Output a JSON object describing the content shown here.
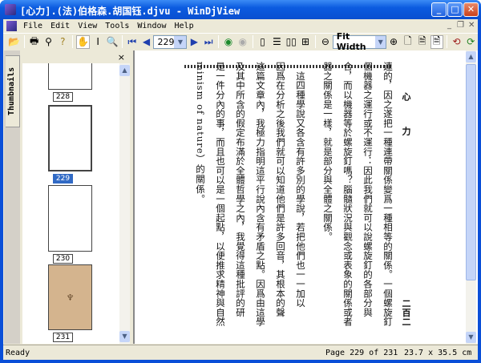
{
  "window": {
    "title": "[心力].(法)伯格森.胡国钰.djvu - WinDjView"
  },
  "menu": [
    "File",
    "Edit",
    "View",
    "Tools",
    "Window",
    "Help"
  ],
  "toolbar": {
    "page_value": "229",
    "zoom_value": "Fit Width"
  },
  "sidebar": {
    "tab_label": "Thumbnails",
    "close": "×",
    "thumbnails": [
      {
        "label": "228"
      },
      {
        "label": "229",
        "selected": true
      },
      {
        "label": "230"
      },
      {
        "label": "231"
      }
    ]
  },
  "page": {
    "header_title": "心 力",
    "page_number": "二百二",
    "columns": [
      "連的，因之遂把一種連帶關係變爲一種相等的關係。一個螺旋釘",
      "個機器之運行或不運行：因此我們就可以說螺旋釘的各部分與",
      "合，而以機器等於螺旋釘嗎？腦髓狀況與觀念或表象的關係或者",
      "器之關係是一樣，就是部分與全體之關係。",
      "　這四種學說又各含有許多別的學說，若把他們也一一加以",
      "因爲在分析之後我們就可以知道他們是許多回音，其根本的聲",
      "這篇文章內，我極力指明這平行說內含有矛盾之點。因爲由這學",
      "及其中所含的假定布滿於全體哲學之內，我覺得這種批評的研",
      "是一件分內的事，而且也可以是一個起點，以便推求精神與自然",
      "minism of nature）的關係。"
    ]
  },
  "status": {
    "left": "Ready",
    "page": "Page 229 of 231",
    "size": "23.7 x 35.5 cm"
  }
}
